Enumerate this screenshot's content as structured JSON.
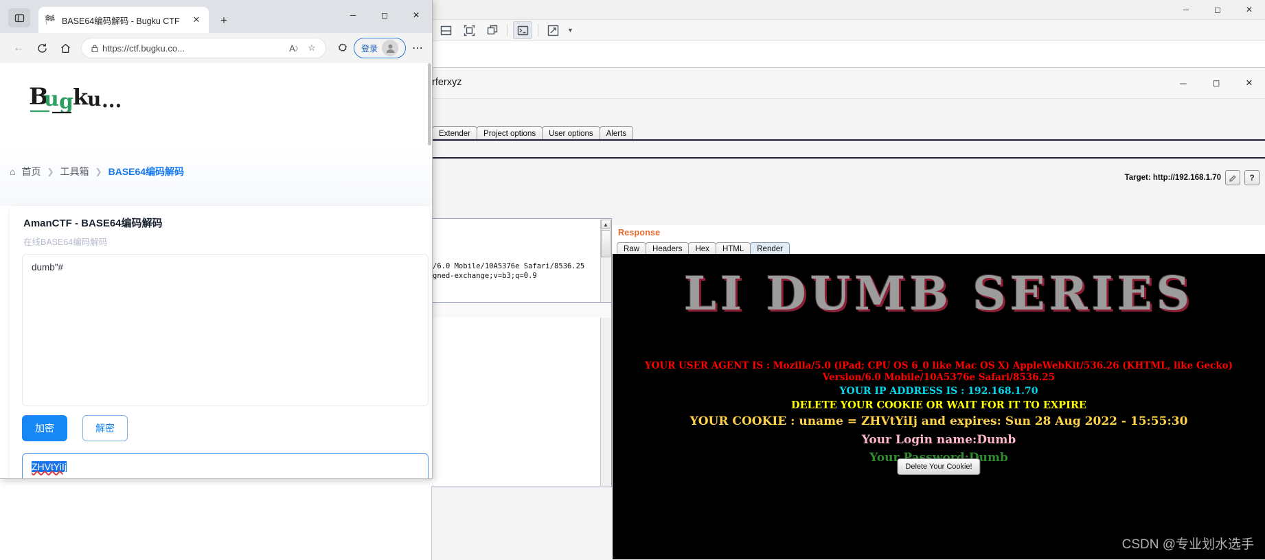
{
  "burp": {
    "window_title": "rferxyz",
    "titlebar_buttons": [
      "minimize",
      "restore",
      "close"
    ],
    "toolbar_icons": [
      "split-horizontal-icon",
      "fit-window-icon",
      "detach-window-icon",
      "terminal-icon",
      "expand-arrow-icon",
      "chevron-down-icon"
    ],
    "main_tabs": [
      "Extender",
      "Project options",
      "User options",
      "Alerts"
    ],
    "target_label": "Target: http://192.168.1.70",
    "target_buttons": [
      "pencil-icon",
      "?"
    ],
    "request_text_lines": [
      "/6.0 Mobile/10A5376e Safari/8536.25",
      "gned-exchange;v=b3;q=0.9"
    ],
    "response": {
      "label": "Response",
      "tabs": [
        "Raw",
        "Headers",
        "Hex",
        "HTML",
        "Render"
      ],
      "active_tab": "Render"
    },
    "render": {
      "banner": "LI DUMB SERIES",
      "user_agent_line": "YOUR USER AGENT IS : Mozilla/5.0 (iPad; CPU OS 6_0 like Mac OS X) AppleWebKit/536.26 (KHTML, like Gecko) Version/6.0 Mobile/10A5376e Safari/8536.25",
      "ip_line": "YOUR IP ADDRESS IS : 192.168.1.70",
      "delete_line": "DELETE YOUR COOKIE OR WAIT FOR IT TO EXPIRE",
      "cookie_line": "YOUR COOKIE : uname = ZHVtYiIj and expires: Sun 28 Aug 2022 - 15:55:30",
      "login_line": "Your Login name:Dumb",
      "password_line": "Your Password:Dumb",
      "delete_button": "Delete Your Cookie!",
      "watermark": "CSDN @专业划水选手",
      "colors": {
        "user_agent": "#ff0000",
        "ip": "#00d8f0",
        "delete": "#ffff00",
        "cookie": "#ffd24a",
        "login": "#ffb6c8",
        "password": "#2e8b2e",
        "background": "#000000"
      }
    }
  },
  "edge": {
    "tab": {
      "title": "BASE64编码解码 - Bugku CTF",
      "favicon": "flag-icon"
    },
    "new_tab_label": "+",
    "window_buttons": [
      "minimize",
      "maximize",
      "close"
    ],
    "nav": {
      "back": "back-arrow-icon",
      "reload": "reload-icon",
      "home": "home-icon",
      "url": "https://ctf.bugku.co...",
      "lock": "lock-icon",
      "read_aloud": "read-aloud-icon",
      "favorite": "add-favorite-icon",
      "collections": "collections-icon",
      "more": "more-options-icon",
      "login_label": "登录"
    },
    "page": {
      "brand": "Bugku",
      "breadcrumb": {
        "home_icon": "home-icon",
        "items": [
          "首页",
          "工具箱"
        ],
        "current": "BASE64编码解码"
      },
      "card": {
        "title": "AmanCTF - BASE64编码解码",
        "subtitle": "在线BASE64编码解码",
        "input_value": "dumb\"#",
        "input_placeholder": "",
        "encode_button": "加密",
        "decode_button": "解密",
        "output_value": "ZHVtYiIj"
      }
    }
  }
}
